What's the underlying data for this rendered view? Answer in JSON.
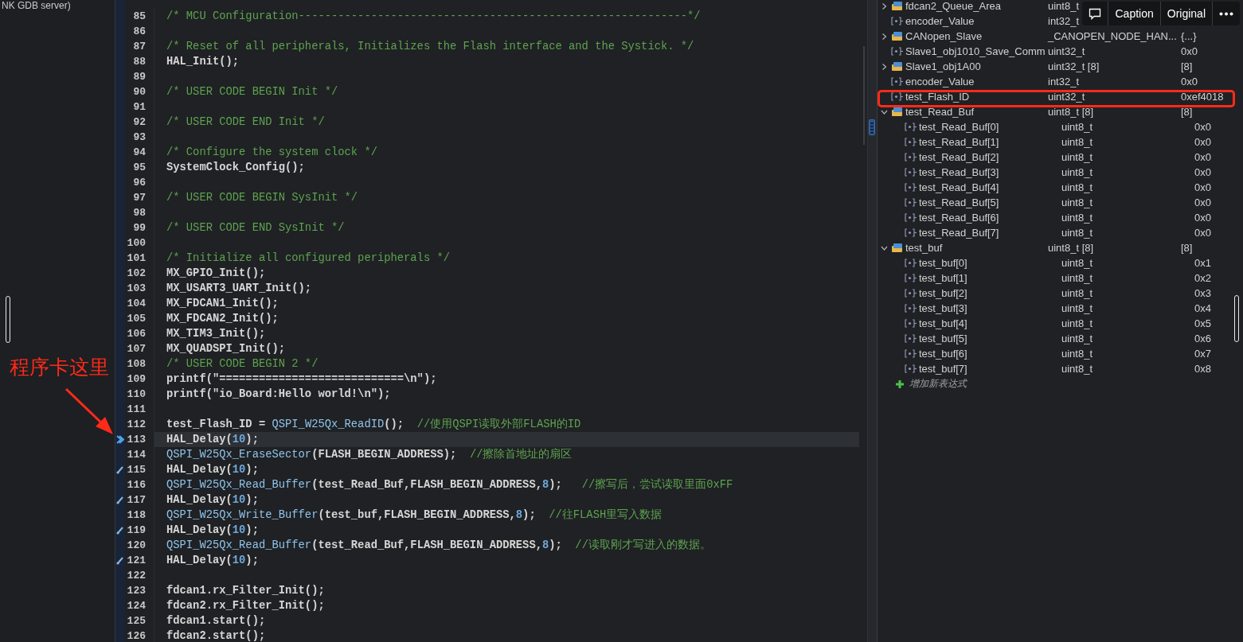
{
  "left_panel": {
    "text": "NK GDB server)"
  },
  "annotation": {
    "text": "程序卡这里"
  },
  "editor": {
    "lines": [
      {
        "number": "85",
        "current": false,
        "bookmark": false,
        "code": [
          {
            "kind": "comment",
            "text": "/* MCU Configuration-----------------------------------------------------------*/"
          }
        ]
      },
      {
        "number": "86",
        "current": false,
        "bookmark": false
      },
      {
        "number": "87",
        "current": false,
        "bookmark": false,
        "code": [
          {
            "kind": "comment",
            "text": "/* Reset of all peripherals, Initializes the Flash interface and the Systick. */"
          }
        ]
      },
      {
        "number": "88",
        "current": false,
        "bookmark": false,
        "code": [
          {
            "kind": "plain",
            "text": "HAL_Init();"
          }
        ]
      },
      {
        "number": "89",
        "current": false,
        "bookmark": false
      },
      {
        "number": "90",
        "current": false,
        "bookmark": false,
        "code": [
          {
            "kind": "comment",
            "text": "/* USER CODE BEGIN Init */"
          }
        ]
      },
      {
        "number": "91",
        "current": false,
        "bookmark": false
      },
      {
        "number": "92",
        "current": false,
        "bookmark": false,
        "code": [
          {
            "kind": "comment",
            "text": "/* USER CODE END Init */"
          }
        ]
      },
      {
        "number": "93",
        "current": false,
        "bookmark": false
      },
      {
        "number": "94",
        "current": false,
        "bookmark": false,
        "code": [
          {
            "kind": "comment",
            "text": "/* Configure the system clock */"
          }
        ]
      },
      {
        "number": "95",
        "current": false,
        "bookmark": false,
        "code": [
          {
            "kind": "plain",
            "text": "SystemClock_Config();"
          }
        ]
      },
      {
        "number": "96",
        "current": false,
        "bookmark": false
      },
      {
        "number": "97",
        "current": false,
        "bookmark": false,
        "code": [
          {
            "kind": "comment",
            "text": "/* USER CODE BEGIN SysInit */"
          }
        ]
      },
      {
        "number": "98",
        "current": false,
        "bookmark": false
      },
      {
        "number": "99",
        "current": false,
        "bookmark": false,
        "code": [
          {
            "kind": "comment",
            "text": "/* USER CODE END SysInit */"
          }
        ]
      },
      {
        "number": "100",
        "current": false,
        "bookmark": false
      },
      {
        "number": "101",
        "current": false,
        "bookmark": false,
        "code": [
          {
            "kind": "comment",
            "text": "/* Initialize all configured peripherals */"
          }
        ]
      },
      {
        "number": "102",
        "current": false,
        "bookmark": false,
        "code": [
          {
            "kind": "plain",
            "text": "MX_GPIO_Init();"
          }
        ]
      },
      {
        "number": "103",
        "current": false,
        "bookmark": false,
        "code": [
          {
            "kind": "plain",
            "text": "MX_USART3_UART_Init();"
          }
        ]
      },
      {
        "number": "104",
        "current": false,
        "bookmark": false,
        "code": [
          {
            "kind": "plain",
            "text": "MX_FDCAN1_Init();"
          }
        ]
      },
      {
        "number": "105",
        "current": false,
        "bookmark": false,
        "code": [
          {
            "kind": "plain",
            "text": "MX_FDCAN2_Init();"
          }
        ]
      },
      {
        "number": "106",
        "current": false,
        "bookmark": false,
        "code": [
          {
            "kind": "plain",
            "text": "MX_TIM3_Init();"
          }
        ]
      },
      {
        "number": "107",
        "current": false,
        "bookmark": false,
        "code": [
          {
            "kind": "plain",
            "text": "MX_QUADSPI_Init();"
          }
        ]
      },
      {
        "number": "108",
        "current": false,
        "bookmark": false,
        "code": [
          {
            "kind": "comment",
            "text": "/* USER CODE BEGIN 2 */"
          }
        ]
      },
      {
        "number": "109",
        "current": false,
        "bookmark": false,
        "code": [
          {
            "kind": "plain",
            "text": "printf(\"============================\\n\");"
          }
        ]
      },
      {
        "number": "110",
        "current": false,
        "bookmark": false,
        "code": [
          {
            "kind": "plain",
            "text": "printf(\"io_Board:Hello world!\\n\");"
          }
        ]
      },
      {
        "number": "111",
        "current": false,
        "bookmark": false
      },
      {
        "number": "112",
        "current": false,
        "bookmark": false,
        "code": [
          {
            "kind": "plain",
            "text": "test_Flash_ID = "
          },
          {
            "kind": "function",
            "text": "QSPI_W25Qx_ReadID"
          },
          {
            "kind": "plain",
            "text": "();  "
          },
          {
            "kind": "comment",
            "text": "//使用QSPI读取外部FLASH的ID"
          }
        ]
      },
      {
        "number": "113",
        "current": true,
        "bookmark": false,
        "code": [
          {
            "kind": "plain",
            "text": "HAL_Delay("
          },
          {
            "kind": "number",
            "text": "10"
          },
          {
            "kind": "plain",
            "text": ");"
          }
        ]
      },
      {
        "number": "114",
        "current": false,
        "bookmark": false,
        "code": [
          {
            "kind": "function",
            "text": "QSPI_W25Qx_EraseSector"
          },
          {
            "kind": "plain",
            "text": "(FLASH_BEGIN_ADDRESS);  "
          },
          {
            "kind": "comment",
            "text": "//擦除首地址的扇区"
          }
        ]
      },
      {
        "number": "115",
        "current": false,
        "bookmark": true,
        "code": [
          {
            "kind": "plain",
            "text": "HAL_Delay("
          },
          {
            "kind": "number",
            "text": "10"
          },
          {
            "kind": "plain",
            "text": ");"
          }
        ]
      },
      {
        "number": "116",
        "current": false,
        "bookmark": false,
        "code": [
          {
            "kind": "function",
            "text": "QSPI_W25Qx_Read_Buffer"
          },
          {
            "kind": "plain",
            "text": "(test_Read_Buf,FLASH_BEGIN_ADDRESS,"
          },
          {
            "kind": "number",
            "text": "8"
          },
          {
            "kind": "plain",
            "text": ");   "
          },
          {
            "kind": "comment",
            "text": "//擦写后，尝试读取里面0xFF"
          }
        ]
      },
      {
        "number": "117",
        "current": false,
        "bookmark": true,
        "code": [
          {
            "kind": "plain",
            "text": "HAL_Delay("
          },
          {
            "kind": "number",
            "text": "10"
          },
          {
            "kind": "plain",
            "text": ");"
          }
        ]
      },
      {
        "number": "118",
        "current": false,
        "bookmark": false,
        "code": [
          {
            "kind": "function",
            "text": "QSPI_W25Qx_Write_Buffer"
          },
          {
            "kind": "plain",
            "text": "(test_buf,FLASH_BEGIN_ADDRESS,"
          },
          {
            "kind": "number",
            "text": "8"
          },
          {
            "kind": "plain",
            "text": ");  "
          },
          {
            "kind": "comment",
            "text": "//往FLASH里写入数据"
          }
        ]
      },
      {
        "number": "119",
        "current": false,
        "bookmark": true,
        "code": [
          {
            "kind": "plain",
            "text": "HAL_Delay("
          },
          {
            "kind": "number",
            "text": "10"
          },
          {
            "kind": "plain",
            "text": ");"
          }
        ]
      },
      {
        "number": "120",
        "current": false,
        "bookmark": false,
        "code": [
          {
            "kind": "function",
            "text": "QSPI_W25Qx_Read_Buffer"
          },
          {
            "kind": "plain",
            "text": "(test_Read_Buf,FLASH_BEGIN_ADDRESS,"
          },
          {
            "kind": "number",
            "text": "8"
          },
          {
            "kind": "plain",
            "text": ");  "
          },
          {
            "kind": "comment",
            "text": "//读取刚才写进入的数据。"
          }
        ]
      },
      {
        "number": "121",
        "current": false,
        "bookmark": true,
        "code": [
          {
            "kind": "plain",
            "text": "HAL_Delay("
          },
          {
            "kind": "number",
            "text": "10"
          },
          {
            "kind": "plain",
            "text": ");"
          }
        ]
      },
      {
        "number": "122",
        "current": false,
        "bookmark": false
      },
      {
        "number": "123",
        "current": false,
        "bookmark": false,
        "code": [
          {
            "kind": "plain",
            "text": "fdcan1.rx_Filter_Init();"
          }
        ]
      },
      {
        "number": "124",
        "current": false,
        "bookmark": false,
        "code": [
          {
            "kind": "plain",
            "text": "fdcan2.rx_Filter_Init();"
          }
        ]
      },
      {
        "number": "125",
        "current": false,
        "bookmark": false,
        "code": [
          {
            "kind": "plain",
            "text": "fdcan1.start();"
          }
        ]
      },
      {
        "number": "126",
        "current": false,
        "bookmark": false,
        "code": [
          {
            "kind": "plain",
            "text": "fdcan2.start();"
          }
        ]
      }
    ]
  },
  "watch": {
    "rows": [
      {
        "name": "fdcan2_Queue_Area",
        "type": "uint8_t",
        "kind": "struct",
        "expanded": false,
        "boxed": false
      },
      {
        "name": "encoder_Value",
        "type": "int32_t",
        "kind": "var",
        "boxed": false
      },
      {
        "name": "CANopen_Slave",
        "type": "_CANOPEN_NODE_HAN...",
        "value": "{...}",
        "kind": "struct",
        "expanded": false,
        "boxed": false
      },
      {
        "name": "Slave1_obj1010_Save_Comm",
        "type": "uint32_t",
        "value": "0x0",
        "kind": "var",
        "boxed": false
      },
      {
        "name": "Slave1_obj1A00",
        "type": "uint32_t [8]",
        "value": "[8]",
        "kind": "struct",
        "expanded": false,
        "boxed": false
      },
      {
        "name": "encoder_Value",
        "type": "int32_t",
        "value": "0x0",
        "kind": "var",
        "boxed": false
      },
      {
        "name": "test_Flash_ID",
        "type": "uint32_t",
        "value": "0xef4018",
        "kind": "var",
        "boxed": true
      },
      {
        "name": "test_Read_Buf",
        "type": "uint8_t [8]",
        "value": "[8]",
        "kind": "struct",
        "expanded": true,
        "boxed": false,
        "children": [
          {
            "name": "test_Read_Buf[0]",
            "type": "uint8_t",
            "value": "0x0",
            "kind": "var"
          },
          {
            "name": "test_Read_Buf[1]",
            "type": "uint8_t",
            "value": "0x0",
            "kind": "var"
          },
          {
            "name": "test_Read_Buf[2]",
            "type": "uint8_t",
            "value": "0x0",
            "kind": "var"
          },
          {
            "name": "test_Read_Buf[3]",
            "type": "uint8_t",
            "value": "0x0",
            "kind": "var"
          },
          {
            "name": "test_Read_Buf[4]",
            "type": "uint8_t",
            "value": "0x0",
            "kind": "var"
          },
          {
            "name": "test_Read_Buf[5]",
            "type": "uint8_t",
            "value": "0x0",
            "kind": "var"
          },
          {
            "name": "test_Read_Buf[6]",
            "type": "uint8_t",
            "value": "0x0",
            "kind": "var"
          },
          {
            "name": "test_Read_Buf[7]",
            "type": "uint8_t",
            "value": "0x0",
            "kind": "var"
          }
        ]
      },
      {
        "name": "test_buf",
        "type": "uint8_t [8]",
        "value": "[8]",
        "kind": "struct",
        "expanded": true,
        "boxed": false,
        "children": [
          {
            "name": "test_buf[0]",
            "type": "uint8_t",
            "value": "0x1",
            "kind": "var"
          },
          {
            "name": "test_buf[1]",
            "type": "uint8_t",
            "value": "0x2",
            "kind": "var"
          },
          {
            "name": "test_buf[2]",
            "type": "uint8_t",
            "value": "0x3",
            "kind": "var"
          },
          {
            "name": "test_buf[3]",
            "type": "uint8_t",
            "value": "0x4",
            "kind": "var"
          },
          {
            "name": "test_buf[4]",
            "type": "uint8_t",
            "value": "0x5",
            "kind": "var"
          },
          {
            "name": "test_buf[5]",
            "type": "uint8_t",
            "value": "0x6",
            "kind": "var"
          },
          {
            "name": "test_buf[6]",
            "type": "uint8_t",
            "value": "0x7",
            "kind": "var"
          },
          {
            "name": "test_buf[7]",
            "type": "uint8_t",
            "value": "0x8",
            "kind": "var"
          }
        ]
      }
    ],
    "add_expression": "增加新表达式"
  },
  "overlay_toolbar": {
    "buttons": [
      {
        "kind": "comment"
      },
      {
        "kind": "text",
        "label": "Caption"
      },
      {
        "kind": "text",
        "label": "Original"
      },
      {
        "kind": "more"
      }
    ]
  }
}
